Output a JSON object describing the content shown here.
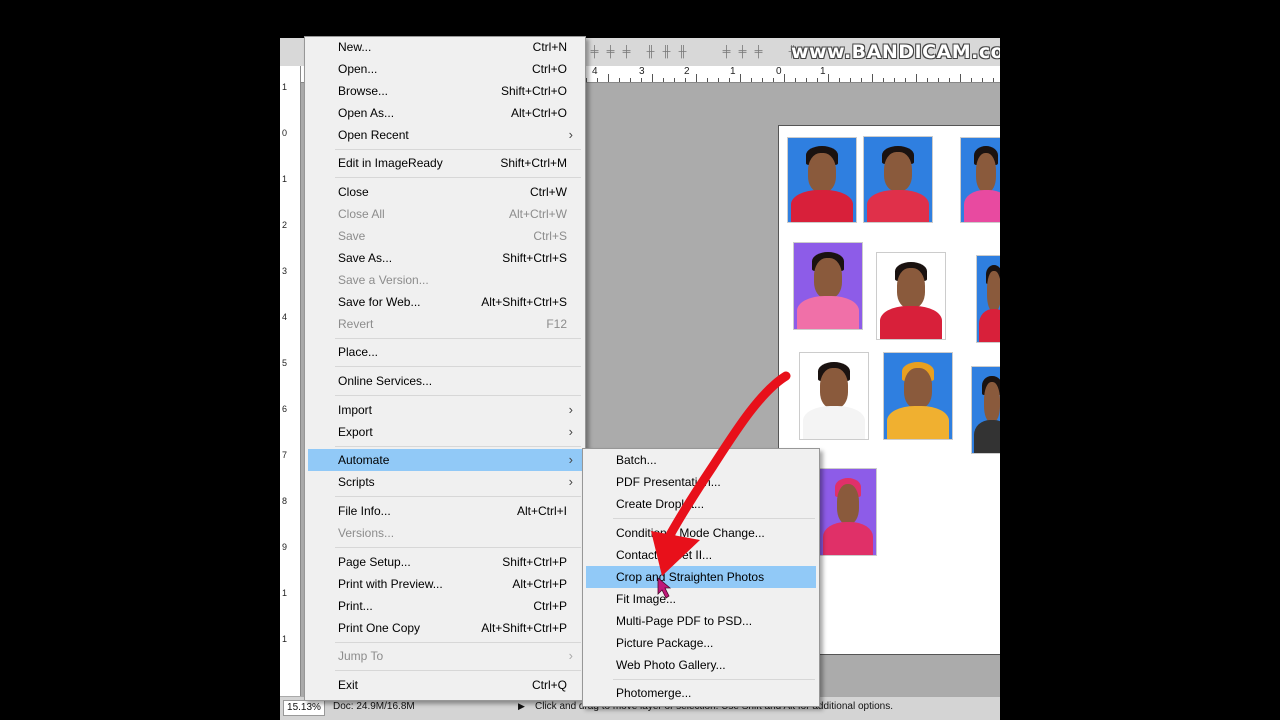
{
  "watermark": "www.BANDICAM.com",
  "ruler": {
    "h_labels": [
      "4",
      "3",
      "2",
      "1",
      "0",
      "1"
    ],
    "v_labels": [
      "1",
      "0",
      "1",
      "2",
      "3",
      "4",
      "5",
      "6",
      "7",
      "8",
      "9",
      "1",
      "1"
    ]
  },
  "status": {
    "zoom": "15.13%",
    "doc": "Doc: 24.9M/16.8M",
    "hint": "Click and drag to move layer or selection.  Use Shift and Alt for additional options."
  },
  "file_menu": {
    "items": [
      {
        "label": "New...",
        "shortcut": "Ctrl+N"
      },
      {
        "label": "Open...",
        "shortcut": "Ctrl+O"
      },
      {
        "label": "Browse...",
        "shortcut": "Shift+Ctrl+O"
      },
      {
        "label": "Open As...",
        "shortcut": "Alt+Ctrl+O"
      },
      {
        "label": "Open Recent",
        "shortcut": ""
      },
      {
        "label": "Edit in ImageReady",
        "shortcut": "Shift+Ctrl+M"
      },
      {
        "label": "Close",
        "shortcut": "Ctrl+W"
      },
      {
        "label": "Close All",
        "shortcut": "Alt+Ctrl+W"
      },
      {
        "label": "Save",
        "shortcut": "Ctrl+S"
      },
      {
        "label": "Save As...",
        "shortcut": "Shift+Ctrl+S"
      },
      {
        "label": "Save a Version...",
        "shortcut": ""
      },
      {
        "label": "Save for Web...",
        "shortcut": "Alt+Shift+Ctrl+S"
      },
      {
        "label": "Revert",
        "shortcut": "F12"
      },
      {
        "label": "Place...",
        "shortcut": ""
      },
      {
        "label": "Online Services...",
        "shortcut": ""
      },
      {
        "label": "Import",
        "shortcut": ""
      },
      {
        "label": "Export",
        "shortcut": ""
      },
      {
        "label": "Automate",
        "shortcut": ""
      },
      {
        "label": "Scripts",
        "shortcut": ""
      },
      {
        "label": "File Info...",
        "shortcut": "Alt+Ctrl+I"
      },
      {
        "label": "Versions...",
        "shortcut": ""
      },
      {
        "label": "Page Setup...",
        "shortcut": "Shift+Ctrl+P"
      },
      {
        "label": "Print with Preview...",
        "shortcut": "Alt+Ctrl+P"
      },
      {
        "label": "Print...",
        "shortcut": "Ctrl+P"
      },
      {
        "label": "Print One Copy",
        "shortcut": "Alt+Shift+Ctrl+P"
      },
      {
        "label": "Jump To",
        "shortcut": ""
      },
      {
        "label": "Exit",
        "shortcut": "Ctrl+Q"
      }
    ]
  },
  "automate_menu": {
    "items": [
      {
        "label": "Batch..."
      },
      {
        "label": "PDF Presentation..."
      },
      {
        "label": "Create Droplet..."
      },
      {
        "label": "Conditional Mode Change..."
      },
      {
        "label": "Contact Sheet II..."
      },
      {
        "label": "Crop and Straighten Photos"
      },
      {
        "label": "Fit Image..."
      },
      {
        "label": "Multi-Page PDF to PSD..."
      },
      {
        "label": "Picture Package..."
      },
      {
        "label": "Web Photo Gallery..."
      },
      {
        "label": "Photomerge..."
      }
    ]
  },
  "colors": {
    "highlight": "#91c9f7",
    "annotation_arrow": "#e8101a",
    "cursor": "#c0187a",
    "photo_bg_blue": "#2f7fe0",
    "photo_bg_purple": "#8d5ce8",
    "photo_bg_white": "#ffffff"
  },
  "icons": [
    "submenu-arrow-icon",
    "mouse-cursor-icon",
    "red-annotation-arrow-icon"
  ]
}
